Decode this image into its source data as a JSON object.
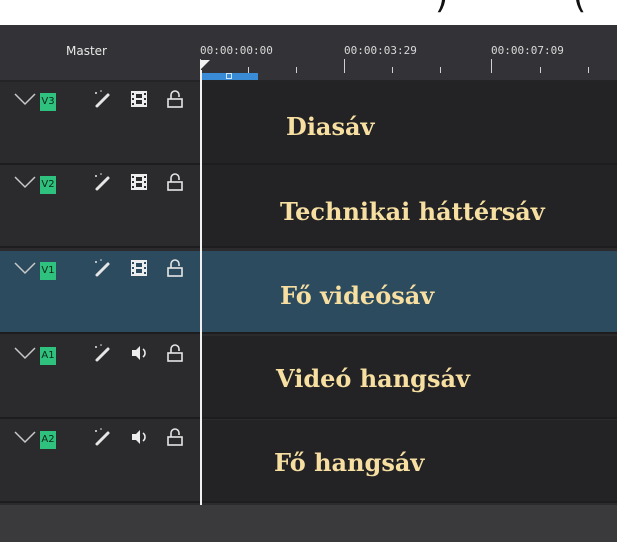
{
  "top_fragment": {
    "left_glyph": ")",
    "right_glyph": "("
  },
  "header": {
    "master_label": "Master",
    "ruler_ticks": [
      "00:00:00:00",
      "00:00:03:29",
      "00:00:07:09"
    ]
  },
  "tracks": [
    {
      "tag": "V3",
      "kind": "video",
      "label": "Diasáv",
      "selected": false
    },
    {
      "tag": "V2",
      "kind": "video",
      "label": "Technikai háttérsáv",
      "selected": false
    },
    {
      "tag": "V1",
      "kind": "video",
      "label": "Fő videósáv",
      "selected": true
    },
    {
      "tag": "A1",
      "kind": "audio",
      "label": "Videó hangsáv",
      "selected": false
    },
    {
      "tag": "A2",
      "kind": "audio",
      "label": "Fő hangsáv",
      "selected": false
    }
  ],
  "colors": {
    "track_tag": "#2ec27e",
    "selected_track": "#2d4b5e",
    "lane_text": "#f6dfa1",
    "zone": "#3a8bd6"
  },
  "icons": [
    "chevron-down-icon",
    "magic-wand-icon",
    "film-strip-icon",
    "speaker-icon",
    "unlocked-padlock-icon"
  ]
}
